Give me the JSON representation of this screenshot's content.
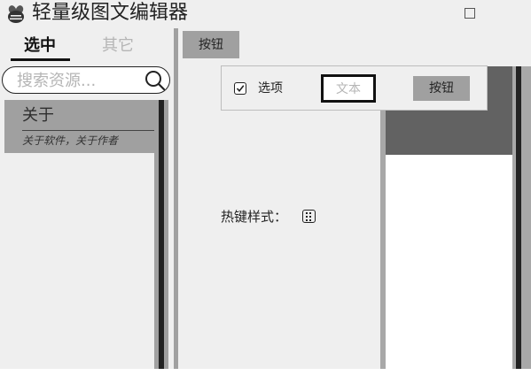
{
  "window": {
    "title": "轻量级图文编辑器",
    "app_icon": "bee-icon",
    "maximize_icon": "maximize-icon"
  },
  "left_panel": {
    "tabs": [
      {
        "label": "选中",
        "selected": true
      },
      {
        "label": "其它",
        "selected": false
      }
    ],
    "search": {
      "placeholder": "搜索资源...",
      "value": "",
      "icon": "search-icon"
    },
    "resources": [
      {
        "title": "关于",
        "subtitle": "关于软件，关于作者"
      }
    ]
  },
  "main": {
    "top_button_label": "按钮",
    "toolbar": {
      "checkbox_label": "选项",
      "checkbox_checked": true,
      "text_field_value": "文本",
      "button_label": "按钮"
    },
    "hotkey": {
      "label": "热键样式：",
      "icon": "hotkey-icon"
    }
  },
  "colors": {
    "background": "#efefef",
    "panel_gray": "#a0a0a0",
    "dark_gray": "#626262",
    "text_dark": "#222222",
    "text_muted": "#b5b5b5"
  }
}
